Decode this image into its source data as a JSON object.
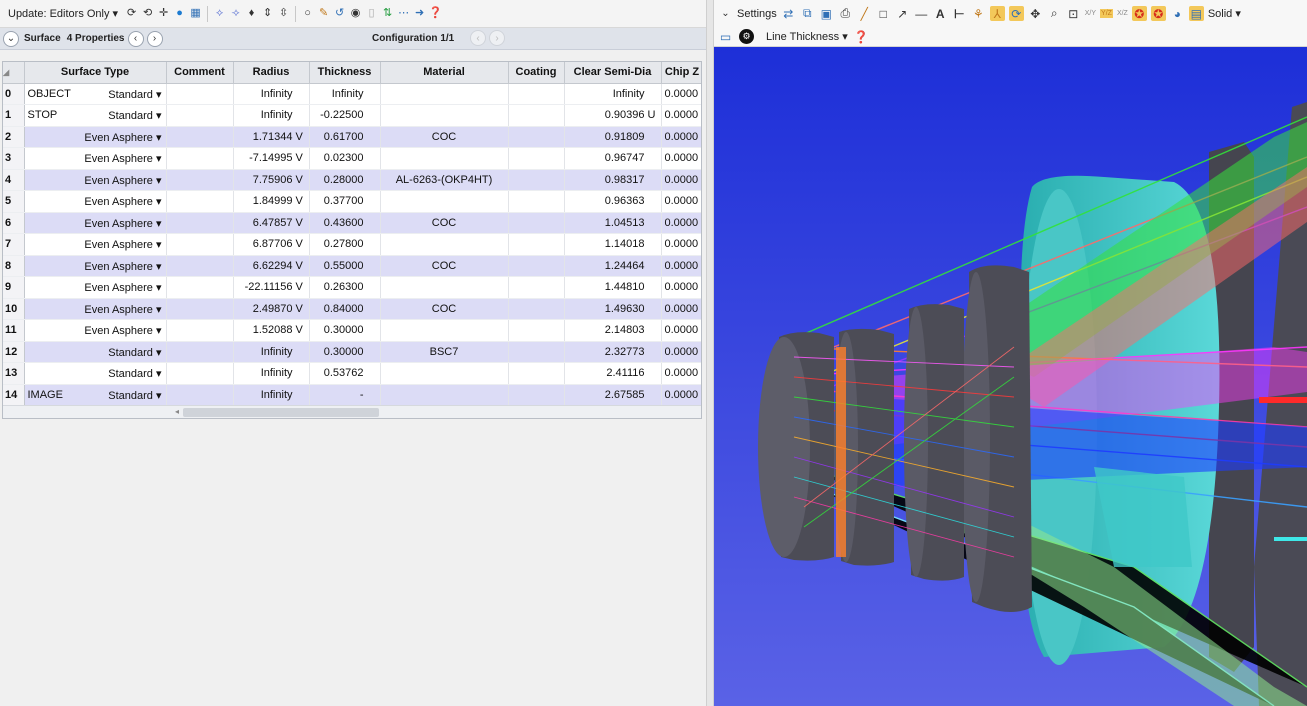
{
  "left_toolbar": {
    "update_label": "Update: Editors Only ▾",
    "icons": [
      "refresh-icon",
      "refresh-all-icon",
      "add-icon",
      "globe-icon",
      "grid-icon",
      "ray-fan-icon",
      "ray-fan-2-icon",
      "pin-icon",
      "flip-icon",
      "flip-2-icon",
      "circle-icon",
      "pencil-icon",
      "clip-icon",
      "toggle-icon",
      "page-icon",
      "swap-icon",
      "dots-arrow-icon",
      "arrow-right-icon",
      "help-icon"
    ]
  },
  "lde_header": {
    "surface_label": "Surface",
    "properties_label": "4 Properties",
    "config_label": "Configuration 1/1"
  },
  "table": {
    "columns": [
      "Surface Type",
      "Comment",
      "Radius",
      "Thickness",
      "Material",
      "Coating",
      "Clear Semi-Dia",
      "Chip Z"
    ],
    "rows": [
      {
        "num": "0",
        "label": "OBJECT",
        "type": "Standard ▾",
        "comment": "",
        "radius": "Infinity",
        "rsolve": "",
        "thickness": "Infinity",
        "tsolve": "",
        "material": "",
        "coating": "",
        "semidia": "Infinity",
        "ssolve": "",
        "chip": "0.0000"
      },
      {
        "num": "1",
        "label": "STOP",
        "type": "Standard ▾",
        "comment": "",
        "radius": "Infinity",
        "rsolve": "",
        "thickness": "-0.22500",
        "tsolve": "",
        "material": "",
        "coating": "",
        "semidia": "0.90396",
        "ssolve": "U",
        "chip": "0.0000"
      },
      {
        "num": "2",
        "label": "",
        "type": "Even Asphere ▾",
        "comment": "",
        "radius": "1.71344",
        "rsolve": "V",
        "thickness": "0.61700",
        "tsolve": "",
        "material": "COC",
        "coating": "",
        "semidia": "0.91809",
        "ssolve": "",
        "chip": "0.0000"
      },
      {
        "num": "3",
        "label": "",
        "type": "Even Asphere ▾",
        "comment": "",
        "radius": "-7.14995",
        "rsolve": "V",
        "thickness": "0.02300",
        "tsolve": "",
        "material": "",
        "coating": "",
        "semidia": "0.96747",
        "ssolve": "",
        "chip": "0.0000"
      },
      {
        "num": "4",
        "label": "",
        "type": "Even Asphere ▾",
        "comment": "",
        "radius": "7.75906",
        "rsolve": "V",
        "thickness": "0.28000",
        "tsolve": "",
        "material": "AL-6263-(OKP4HT)",
        "coating": "",
        "semidia": "0.98317",
        "ssolve": "",
        "chip": "0.0000"
      },
      {
        "num": "5",
        "label": "",
        "type": "Even Asphere ▾",
        "comment": "",
        "radius": "1.84999",
        "rsolve": "V",
        "thickness": "0.37700",
        "tsolve": "",
        "material": "",
        "coating": "",
        "semidia": "0.96363",
        "ssolve": "",
        "chip": "0.0000"
      },
      {
        "num": "6",
        "label": "",
        "type": "Even Asphere ▾",
        "comment": "",
        "radius": "6.47857",
        "rsolve": "V",
        "thickness": "0.43600",
        "tsolve": "",
        "material": "COC",
        "coating": "",
        "semidia": "1.04513",
        "ssolve": "",
        "chip": "0.0000"
      },
      {
        "num": "7",
        "label": "",
        "type": "Even Asphere ▾",
        "comment": "",
        "radius": "6.87706",
        "rsolve": "V",
        "thickness": "0.27800",
        "tsolve": "",
        "material": "",
        "coating": "",
        "semidia": "1.14018",
        "ssolve": "",
        "chip": "0.0000"
      },
      {
        "num": "8",
        "label": "",
        "type": "Even Asphere ▾",
        "comment": "",
        "radius": "6.62294",
        "rsolve": "V",
        "thickness": "0.55000",
        "tsolve": "",
        "material": "COC",
        "coating": "",
        "semidia": "1.24464",
        "ssolve": "",
        "chip": "0.0000"
      },
      {
        "num": "9",
        "label": "",
        "type": "Even Asphere ▾",
        "comment": "",
        "radius": "-22.11156",
        "rsolve": "V",
        "thickness": "0.26300",
        "tsolve": "",
        "material": "",
        "coating": "",
        "semidia": "1.44810",
        "ssolve": "",
        "chip": "0.0000"
      },
      {
        "num": "10",
        "label": "",
        "type": "Even Asphere ▾",
        "comment": "",
        "radius": "2.49870",
        "rsolve": "V",
        "thickness": "0.84000",
        "tsolve": "",
        "material": "COC",
        "coating": "",
        "semidia": "1.49630",
        "ssolve": "",
        "chip": "0.0000"
      },
      {
        "num": "11",
        "label": "",
        "type": "Even Asphere ▾",
        "comment": "",
        "radius": "1.52088",
        "rsolve": "V",
        "thickness": "0.30000",
        "tsolve": "",
        "material": "",
        "coating": "",
        "semidia": "2.14803",
        "ssolve": "",
        "chip": "0.0000"
      },
      {
        "num": "12",
        "label": "",
        "type": "Standard ▾",
        "comment": "",
        "radius": "Infinity",
        "rsolve": "",
        "thickness": "0.30000",
        "tsolve": "",
        "material": "BSC7",
        "coating": "",
        "semidia": "2.32773",
        "ssolve": "",
        "chip": "0.0000"
      },
      {
        "num": "13",
        "label": "",
        "type": "Standard ▾",
        "comment": "",
        "radius": "Infinity",
        "rsolve": "",
        "thickness": "0.53762",
        "tsolve": "",
        "material": "",
        "coating": "",
        "semidia": "2.41116",
        "ssolve": "",
        "chip": "0.0000"
      },
      {
        "num": "14",
        "label": "IMAGE",
        "type": "Standard ▾",
        "comment": "",
        "radius": "Infinity",
        "rsolve": "",
        "thickness": "-",
        "tsolve": "",
        "material": "",
        "coating": "",
        "semidia": "2.67585",
        "ssolve": "",
        "chip": "0.0000"
      }
    ]
  },
  "right_toolbar": {
    "settings_label": "Settings",
    "solid_label": "Solid ▾",
    "line_thickness_label": "Line Thickness ▾",
    "xy_label": "X/Y",
    "yz_label": "Y/Z",
    "xz_label": "X/Z"
  },
  "colors": {
    "alt_row": "#dcdcf6",
    "viewport_top": "#1d2fd8",
    "viewport_bottom": "#5a62e6",
    "lens_body": "#4a4a55",
    "lens_cyan": "#3fc8c8"
  }
}
